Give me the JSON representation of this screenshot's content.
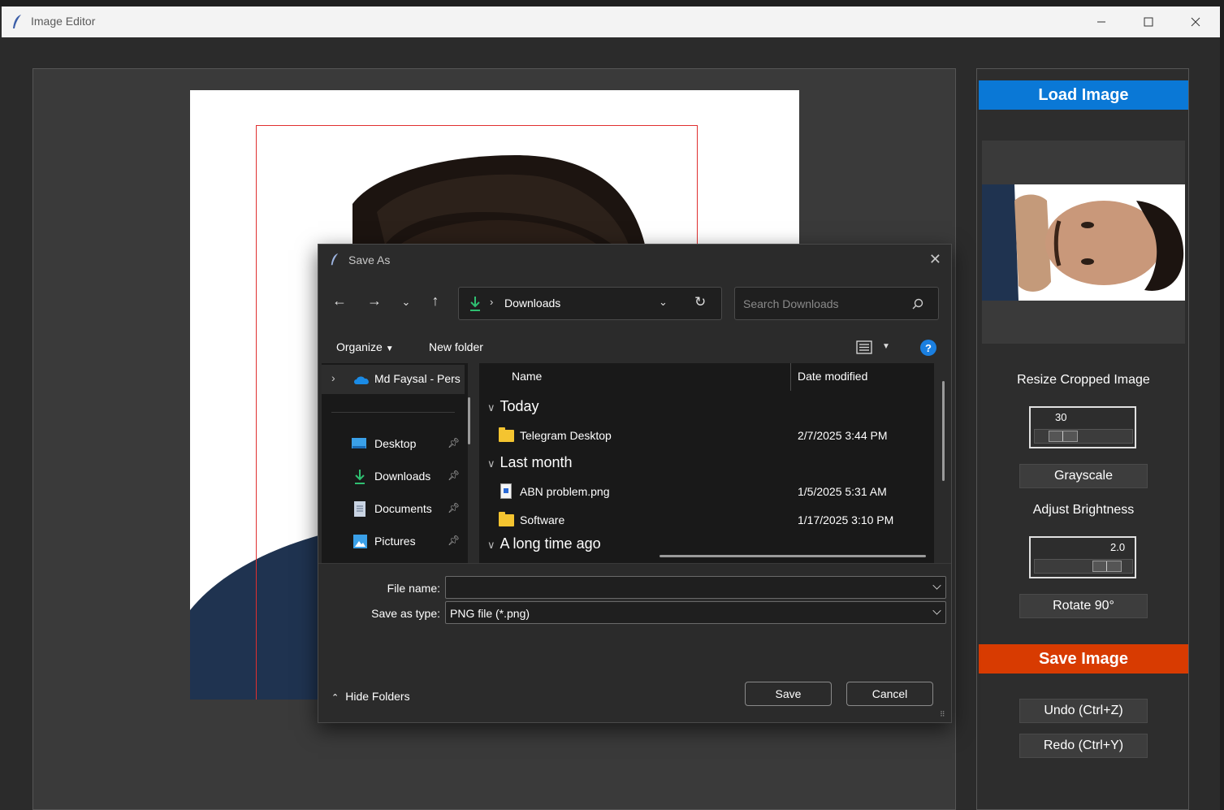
{
  "window": {
    "title": "Image Editor",
    "controls": {
      "minimize": "—",
      "maximize": "☐",
      "close": "✕"
    }
  },
  "sidebar": {
    "load_label": "Load Image",
    "resize_label": "Resize Cropped Image",
    "resize_value": "30",
    "resize_fraction": 0.2,
    "grayscale_label": "Grayscale",
    "brightness_label": "Adjust Brightness",
    "brightness_value": "2.0",
    "brightness_fraction": 0.85,
    "rotate_label": "Rotate 90°",
    "save_label": "Save Image",
    "undo_label": "Undo (Ctrl+Z)",
    "redo_label": "Redo (Ctrl+Y)",
    "colors": {
      "load": "#0a78d6",
      "save": "#d83b01",
      "crop_rect": "#e03030"
    }
  },
  "dialog": {
    "title": "Save As",
    "address": {
      "location": "Downloads"
    },
    "search_placeholder": "Search Downloads",
    "toolbar": {
      "organize": "Organize",
      "new_folder": "New folder"
    },
    "nav": {
      "cloud_item": "Md Faysal - Pers",
      "items": [
        {
          "label": "Desktop",
          "icon": "desktop-icon"
        },
        {
          "label": "Downloads",
          "icon": "download-icon"
        },
        {
          "label": "Documents",
          "icon": "documents-icon"
        },
        {
          "label": "Pictures",
          "icon": "pictures-icon"
        }
      ]
    },
    "columns": {
      "name": "Name",
      "date": "Date modified"
    },
    "groups": {
      "today": "Today",
      "last_month": "Last month",
      "long_ago": "A long time ago"
    },
    "files": [
      {
        "name": "Telegram Desktop",
        "date": "2/7/2025 3:44 PM",
        "type": "folder"
      },
      {
        "name": "ABN problem.png",
        "date": "1/5/2025 5:31 AM",
        "type": "png"
      },
      {
        "name": "Software",
        "date": "1/17/2025 3:10 PM",
        "type": "folder"
      }
    ],
    "file_name_label": "File name:",
    "file_name_value": "",
    "save_type_label": "Save as type:",
    "save_type_value": "PNG file (*.png)",
    "hide_folders": "Hide Folders",
    "save_button": "Save",
    "cancel_button": "Cancel"
  }
}
